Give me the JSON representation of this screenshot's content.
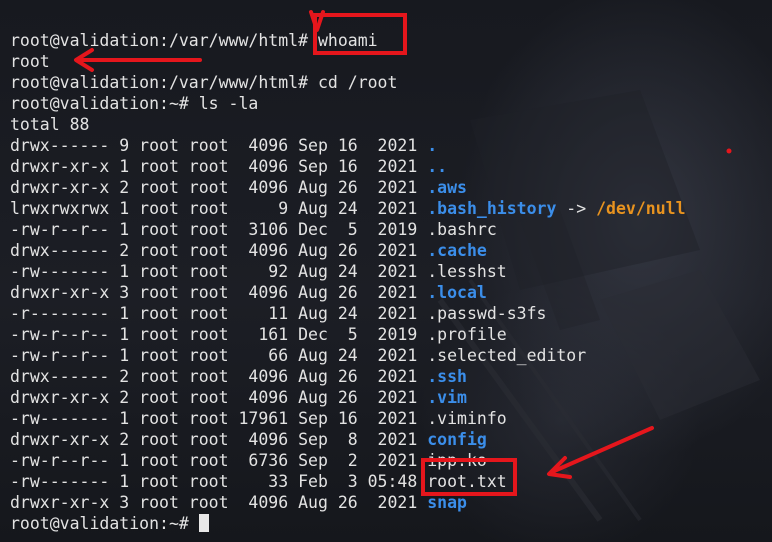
{
  "terminal": {
    "lines": [
      {
        "prompt": "root@validation:/var/www/html# ",
        "command": "whoami"
      },
      {
        "text": "root"
      },
      {
        "prompt": "root@validation:/var/www/html# ",
        "command": "cd /root"
      },
      {
        "prompt": "root@validation:~# ",
        "command": "ls -la"
      },
      {
        "text": "total 88"
      }
    ],
    "entries": [
      {
        "meta": "drwx------ 9 root root  4096 Sep 16  2021 ",
        "name": ".",
        "kind": "dir"
      },
      {
        "meta": "drwxr-xr-x 1 root root  4096 Sep 16  2021 ",
        "name": "..",
        "kind": "dir"
      },
      {
        "meta": "drwxr-xr-x 2 root root  4096 Aug 26  2021 ",
        "name": ".aws",
        "kind": "dir"
      },
      {
        "meta": "lrwxrwxrwx 1 root root     9 Aug 24  2021 ",
        "name": ".bash_history",
        "kind": "link",
        "arrow": " -> ",
        "target": "/dev/null"
      },
      {
        "meta": "-rw-r--r-- 1 root root  3106 Dec  5  2019 ",
        "name": ".bashrc",
        "kind": "file"
      },
      {
        "meta": "drwx------ 2 root root  4096 Aug 26  2021 ",
        "name": ".cache",
        "kind": "dir"
      },
      {
        "meta": "-rw------- 1 root root    92 Aug 24  2021 ",
        "name": ".lesshst",
        "kind": "file"
      },
      {
        "meta": "drwxr-xr-x 3 root root  4096 Aug 26  2021 ",
        "name": ".local",
        "kind": "dir"
      },
      {
        "meta": "-r-------- 1 root root    11 Aug 24  2021 ",
        "name": ".passwd-s3fs",
        "kind": "file"
      },
      {
        "meta": "-rw-r--r-- 1 root root   161 Dec  5  2019 ",
        "name": ".profile",
        "kind": "file"
      },
      {
        "meta": "-rw-r--r-- 1 root root    66 Aug 24  2021 ",
        "name": ".selected_editor",
        "kind": "file"
      },
      {
        "meta": "drwx------ 2 root root  4096 Aug 26  2021 ",
        "name": ".ssh",
        "kind": "dir"
      },
      {
        "meta": "drwxr-xr-x 2 root root  4096 Aug 26  2021 ",
        "name": ".vim",
        "kind": "dir"
      },
      {
        "meta": "-rw------- 1 root root 17961 Sep 16  2021 ",
        "name": ".viminfo",
        "kind": "file"
      },
      {
        "meta": "drwxr-xr-x 2 root root  4096 Sep  8  2021 ",
        "name": "config",
        "kind": "dir"
      },
      {
        "meta": "-rw-r--r-- 1 root root  6736 Sep  2  2021 ",
        "name": "ipp.ko",
        "kind": "file"
      },
      {
        "meta": "-rw------- 1 root root    33 Feb  3 05:48 ",
        "name": "root.txt",
        "kind": "file"
      },
      {
        "meta": "drwxr-xr-x 3 root root  4096 Aug 26  2021 ",
        "name": "snap",
        "kind": "dir"
      }
    ],
    "final_prompt": "root@validation:~# "
  },
  "colors": {
    "directory": "#3b8eea",
    "symlink_target": "#e8931f",
    "text": "#e3e3e3",
    "annotation": "#e5161c"
  },
  "icons": [
    "arrow-annotation-icon",
    "highlight-box"
  ]
}
